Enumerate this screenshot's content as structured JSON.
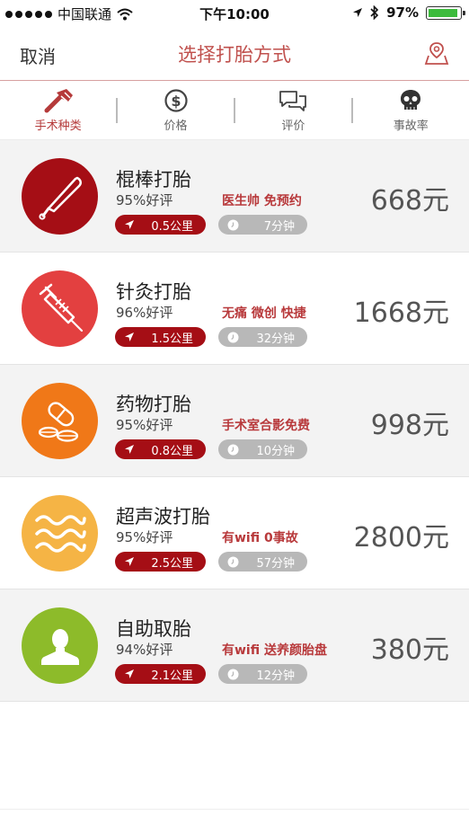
{
  "status_bar": {
    "carrier": "中国联通",
    "time": "下午10:00",
    "battery": "97%",
    "battery_level": 0.97
  },
  "nav": {
    "cancel": "取消",
    "title": "选择打胎方式"
  },
  "filters": [
    {
      "label": "手术种类",
      "icon": "surgery-tools-icon"
    },
    {
      "label": "价格",
      "icon": "dollar-icon"
    },
    {
      "label": "评价",
      "icon": "chat-bubbles-icon"
    },
    {
      "label": "事故率",
      "icon": "skull-icon"
    }
  ],
  "methods": [
    {
      "name": "棍棒打胎",
      "rating": "95%好评",
      "tags": "医生帅 免预约",
      "price": "668元",
      "distance": "0.5公里",
      "time": "7分钟",
      "icon": "baseball-bat-icon",
      "color": "#a50e15"
    },
    {
      "name": "针灸打胎",
      "rating": "96%好评",
      "tags": "无痛 微创 快捷",
      "price": "1668元",
      "distance": "1.5公里",
      "time": "32分钟",
      "icon": "syringe-icon",
      "color": "#e34040"
    },
    {
      "name": "药物打胎",
      "rating": "95%好评",
      "tags": "手术室合影免费",
      "price": "998元",
      "distance": "0.8公里",
      "time": "10分钟",
      "icon": "pills-icon",
      "color": "#f07818"
    },
    {
      "name": "超声波打胎",
      "rating": "95%好评",
      "tags": "有wifi 0事故",
      "price": "2800元",
      "distance": "2.5公里",
      "time": "57分钟",
      "icon": "waves-icon",
      "color": "#f5b445"
    },
    {
      "name": "自助取胎",
      "rating": "94%好评",
      "tags": "有wifi 送养颜胎盘",
      "price": "380元",
      "distance": "2.1公里",
      "time": "12分钟",
      "icon": "person-icon",
      "color": "#8dbb2a"
    }
  ]
}
